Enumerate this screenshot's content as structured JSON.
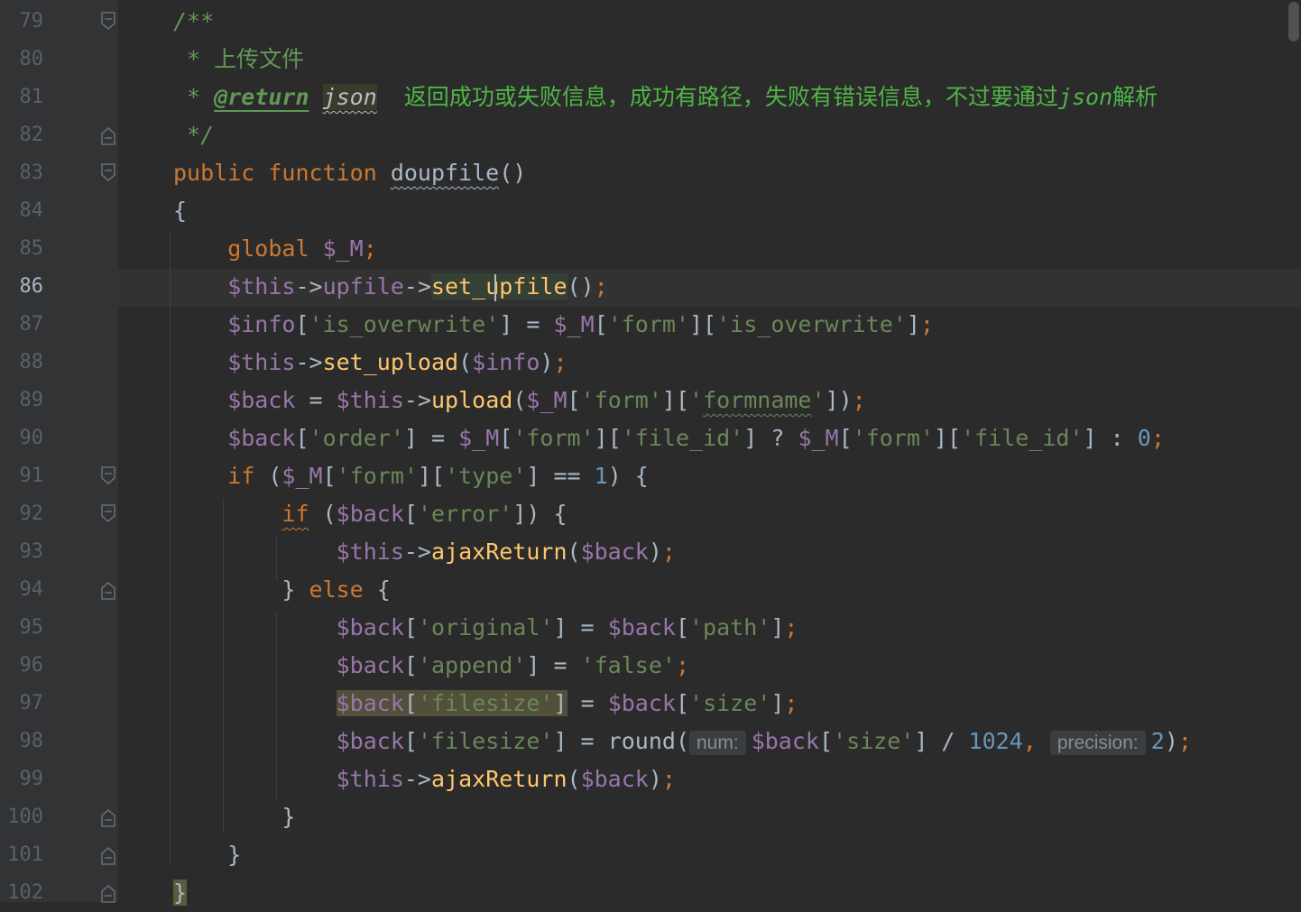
{
  "colors": {
    "background": "#2b2b2b",
    "gutter": "#313335",
    "doc_comment": "#629755",
    "keyword": "#cc7832",
    "variable": "#9876aa",
    "method": "#ffc66d",
    "string": "#6a8759",
    "number": "#6897bb",
    "default": "#a9b7c6",
    "line_number": "#5c6066"
  },
  "editor": {
    "current_line": "86",
    "lines": [
      {
        "num": "79",
        "fold": "collapse",
        "tokens": [
          {
            "t": "/**",
            "c": "#629755",
            "s": "italic"
          }
        ]
      },
      {
        "num": "80",
        "tokens": [
          {
            "t": " * ",
            "c": "#629755",
            "s": "italic"
          },
          {
            "t": "上传文件",
            "c": "#629755"
          }
        ]
      },
      {
        "num": "81",
        "tokens": [
          {
            "t": " * ",
            "c": "#629755",
            "s": "italic"
          },
          {
            "t": "@return",
            "c": "#629755",
            "s": "italic bold link"
          },
          {
            "t": " ",
            "c": "#629755"
          },
          {
            "t": "json",
            "c": "#b8c0c8",
            "s": "italic wavy",
            "bg": "#3b3a2b"
          },
          {
            "t": "  ",
            "c": "#629755"
          },
          {
            "t": "返回成功或失败信息，成功有路径，失败有错误信息，不过要通过",
            "c": "#4fb545"
          },
          {
            "t": "json",
            "c": "#4fb545",
            "s": "italic"
          },
          {
            "t": "解析",
            "c": "#4fb545"
          }
        ]
      },
      {
        "num": "82",
        "fold": "end",
        "tokens": [
          {
            "t": " */",
            "c": "#629755",
            "s": "italic"
          }
        ]
      },
      {
        "num": "83",
        "fold": "collapse",
        "tokens": [
          {
            "t": "public ",
            "c": "#cc7832"
          },
          {
            "t": "function ",
            "c": "#cc7832"
          },
          {
            "t": "doupfile",
            "c": "#a9b7c6",
            "s": "wavy"
          },
          {
            "t": "()",
            "c": "#a9b7c6"
          }
        ]
      },
      {
        "num": "84",
        "tokens": [
          {
            "t": "{",
            "c": "#a9b7c6"
          }
        ]
      },
      {
        "num": "85",
        "tokens": [
          {
            "t": "    global ",
            "c": "#cc7832"
          },
          {
            "t": "$_M",
            "c": "#9876aa"
          },
          {
            "t": ";",
            "c": "#cc7832"
          }
        ]
      },
      {
        "num": "86",
        "tokens": [
          {
            "t": "    $this",
            "c": "#9876aa"
          },
          {
            "t": "->",
            "c": "#a9b7c6"
          },
          {
            "t": "upfile",
            "c": "#9876aa"
          },
          {
            "t": "->",
            "c": "#a9b7c6"
          },
          {
            "t": "set_upfile",
            "c": "#ffc66d",
            "bg": "#344134"
          },
          {
            "t": "()",
            "c": "#a9b7c6"
          },
          {
            "t": ";",
            "c": "#cc7832"
          }
        ]
      },
      {
        "num": "87",
        "tokens": [
          {
            "t": "    $info",
            "c": "#9876aa"
          },
          {
            "t": "[",
            "c": "#a9b7c6"
          },
          {
            "t": "'is_overwrite'",
            "c": "#6a8759"
          },
          {
            "t": "] = ",
            "c": "#a9b7c6"
          },
          {
            "t": "$_M",
            "c": "#9876aa"
          },
          {
            "t": "[",
            "c": "#a9b7c6"
          },
          {
            "t": "'form'",
            "c": "#6a8759"
          },
          {
            "t": "][",
            "c": "#a9b7c6"
          },
          {
            "t": "'is_overwrite'",
            "c": "#6a8759"
          },
          {
            "t": "]",
            "c": "#a9b7c6"
          },
          {
            "t": ";",
            "c": "#cc7832"
          }
        ]
      },
      {
        "num": "88",
        "tokens": [
          {
            "t": "    $this",
            "c": "#9876aa"
          },
          {
            "t": "->",
            "c": "#a9b7c6"
          },
          {
            "t": "set_upload",
            "c": "#ffc66d"
          },
          {
            "t": "(",
            "c": "#a9b7c6"
          },
          {
            "t": "$info",
            "c": "#9876aa"
          },
          {
            "t": ")",
            "c": "#a9b7c6"
          },
          {
            "t": ";",
            "c": "#cc7832"
          }
        ]
      },
      {
        "num": "89",
        "tokens": [
          {
            "t": "    $back",
            "c": "#9876aa"
          },
          {
            "t": " = ",
            "c": "#a9b7c6"
          },
          {
            "t": "$this",
            "c": "#9876aa"
          },
          {
            "t": "->",
            "c": "#a9b7c6"
          },
          {
            "t": "upload",
            "c": "#ffc66d"
          },
          {
            "t": "(",
            "c": "#a9b7c6"
          },
          {
            "t": "$_M",
            "c": "#9876aa"
          },
          {
            "t": "[",
            "c": "#a9b7c6"
          },
          {
            "t": "'form'",
            "c": "#6a8759"
          },
          {
            "t": "][",
            "c": "#a9b7c6"
          },
          {
            "t": "'",
            "c": "#6a8759"
          },
          {
            "t": "formname",
            "c": "#6a8759",
            "s": "wavy"
          },
          {
            "t": "'",
            "c": "#6a8759"
          },
          {
            "t": "])",
            "c": "#a9b7c6"
          },
          {
            "t": ";",
            "c": "#cc7832"
          }
        ]
      },
      {
        "num": "90",
        "tokens": [
          {
            "t": "    $back",
            "c": "#9876aa"
          },
          {
            "t": "[",
            "c": "#a9b7c6"
          },
          {
            "t": "'order'",
            "c": "#6a8759"
          },
          {
            "t": "] = ",
            "c": "#a9b7c6"
          },
          {
            "t": "$_M",
            "c": "#9876aa"
          },
          {
            "t": "[",
            "c": "#a9b7c6"
          },
          {
            "t": "'form'",
            "c": "#6a8759"
          },
          {
            "t": "][",
            "c": "#a9b7c6"
          },
          {
            "t": "'file_id'",
            "c": "#6a8759"
          },
          {
            "t": "] ? ",
            "c": "#a9b7c6"
          },
          {
            "t": "$_M",
            "c": "#9876aa"
          },
          {
            "t": "[",
            "c": "#a9b7c6"
          },
          {
            "t": "'form'",
            "c": "#6a8759"
          },
          {
            "t": "][",
            "c": "#a9b7c6"
          },
          {
            "t": "'file_id'",
            "c": "#6a8759"
          },
          {
            "t": "] : ",
            "c": "#a9b7c6"
          },
          {
            "t": "0",
            "c": "#6897bb"
          },
          {
            "t": ";",
            "c": "#cc7832"
          }
        ]
      },
      {
        "num": "91",
        "fold": "collapse",
        "tokens": [
          {
            "t": "    if ",
            "c": "#cc7832"
          },
          {
            "t": "(",
            "c": "#a9b7c6"
          },
          {
            "t": "$_M",
            "c": "#9876aa"
          },
          {
            "t": "[",
            "c": "#a9b7c6"
          },
          {
            "t": "'form'",
            "c": "#6a8759"
          },
          {
            "t": "][",
            "c": "#a9b7c6"
          },
          {
            "t": "'type'",
            "c": "#6a8759"
          },
          {
            "t": "] == ",
            "c": "#a9b7c6"
          },
          {
            "t": "1",
            "c": "#6897bb"
          },
          {
            "t": ") {",
            "c": "#a9b7c6"
          }
        ]
      },
      {
        "num": "92",
        "fold": "collapse",
        "tokens": [
          {
            "t": "        ",
            "c": "#a9b7c6"
          },
          {
            "t": "if",
            "c": "#cc7832",
            "s": "wavy"
          },
          {
            "t": " (",
            "c": "#a9b7c6"
          },
          {
            "t": "$back",
            "c": "#9876aa"
          },
          {
            "t": "[",
            "c": "#a9b7c6"
          },
          {
            "t": "'error'",
            "c": "#6a8759"
          },
          {
            "t": "]) {",
            "c": "#a9b7c6"
          }
        ]
      },
      {
        "num": "93",
        "tokens": [
          {
            "t": "            $this",
            "c": "#9876aa"
          },
          {
            "t": "->",
            "c": "#a9b7c6"
          },
          {
            "t": "ajaxReturn",
            "c": "#ffc66d"
          },
          {
            "t": "(",
            "c": "#a9b7c6"
          },
          {
            "t": "$back",
            "c": "#9876aa"
          },
          {
            "t": ")",
            "c": "#a9b7c6"
          },
          {
            "t": ";",
            "c": "#cc7832"
          }
        ]
      },
      {
        "num": "94",
        "fold": "end",
        "tokens": [
          {
            "t": "        } ",
            "c": "#a9b7c6"
          },
          {
            "t": "else ",
            "c": "#cc7832"
          },
          {
            "t": "{",
            "c": "#a9b7c6"
          }
        ]
      },
      {
        "num": "95",
        "tokens": [
          {
            "t": "            $back",
            "c": "#9876aa"
          },
          {
            "t": "[",
            "c": "#a9b7c6"
          },
          {
            "t": "'original'",
            "c": "#6a8759"
          },
          {
            "t": "] = ",
            "c": "#a9b7c6"
          },
          {
            "t": "$back",
            "c": "#9876aa"
          },
          {
            "t": "[",
            "c": "#a9b7c6"
          },
          {
            "t": "'path'",
            "c": "#6a8759"
          },
          {
            "t": "]",
            "c": "#a9b7c6"
          },
          {
            "t": ";",
            "c": "#cc7832"
          }
        ]
      },
      {
        "num": "96",
        "tokens": [
          {
            "t": "            $back",
            "c": "#9876aa"
          },
          {
            "t": "[",
            "c": "#a9b7c6"
          },
          {
            "t": "'append'",
            "c": "#6a8759"
          },
          {
            "t": "] = ",
            "c": "#a9b7c6"
          },
          {
            "t": "'false'",
            "c": "#6a8759"
          },
          {
            "t": ";",
            "c": "#cc7832"
          }
        ]
      },
      {
        "num": "97",
        "tokens": [
          {
            "t": "            ",
            "c": "#a9b7c6"
          },
          {
            "t": "$back",
            "c": "#9876aa",
            "bg": "#52503a"
          },
          {
            "t": "[",
            "c": "#a9b7c6",
            "bg": "#52503a"
          },
          {
            "t": "'filesize'",
            "c": "#6a8759",
            "bg": "#52503a"
          },
          {
            "t": "]",
            "c": "#a9b7c6",
            "bg": "#52503a"
          },
          {
            "t": " = ",
            "c": "#a9b7c6"
          },
          {
            "t": "$back",
            "c": "#9876aa"
          },
          {
            "t": "[",
            "c": "#a9b7c6"
          },
          {
            "t": "'size'",
            "c": "#6a8759"
          },
          {
            "t": "]",
            "c": "#a9b7c6"
          },
          {
            "t": ";",
            "c": "#cc7832"
          }
        ]
      },
      {
        "num": "98",
        "tokens": [
          {
            "t": "            $back",
            "c": "#9876aa"
          },
          {
            "t": "[",
            "c": "#a9b7c6"
          },
          {
            "t": "'filesize'",
            "c": "#6a8759"
          },
          {
            "t": "] = ",
            "c": "#a9b7c6"
          },
          {
            "t": "round",
            "c": "#a9b7c6"
          },
          {
            "t": "(",
            "c": "#a9b7c6"
          },
          {
            "t": "num:",
            "c": "#8c8c8c",
            "s": "hint"
          },
          {
            "t": "$back",
            "c": "#9876aa"
          },
          {
            "t": "[",
            "c": "#a9b7c6"
          },
          {
            "t": "'size'",
            "c": "#6a8759"
          },
          {
            "t": "] / ",
            "c": "#a9b7c6"
          },
          {
            "t": "1024",
            "c": "#6897bb"
          },
          {
            "t": ", ",
            "c": "#cc7832"
          },
          {
            "t": "precision:",
            "c": "#8c8c8c",
            "s": "hint"
          },
          {
            "t": "2",
            "c": "#6897bb"
          },
          {
            "t": ")",
            "c": "#a9b7c6"
          },
          {
            "t": ";",
            "c": "#cc7832"
          }
        ]
      },
      {
        "num": "99",
        "tokens": [
          {
            "t": "            $this",
            "c": "#9876aa"
          },
          {
            "t": "->",
            "c": "#a9b7c6"
          },
          {
            "t": "ajaxReturn",
            "c": "#ffc66d"
          },
          {
            "t": "(",
            "c": "#a9b7c6"
          },
          {
            "t": "$back",
            "c": "#9876aa"
          },
          {
            "t": ")",
            "c": "#a9b7c6"
          },
          {
            "t": ";",
            "c": "#cc7832"
          }
        ]
      },
      {
        "num": "100",
        "fold": "end",
        "tokens": [
          {
            "t": "        }",
            "c": "#a9b7c6"
          }
        ]
      },
      {
        "num": "101",
        "fold": "end",
        "tokens": [
          {
            "t": "    }",
            "c": "#a9b7c6"
          }
        ]
      },
      {
        "num": "102",
        "fold": "end",
        "tokens": [
          {
            "t": "}",
            "c": "#a9b7c6",
            "bg": "#5c5a3a"
          }
        ]
      }
    ]
  }
}
